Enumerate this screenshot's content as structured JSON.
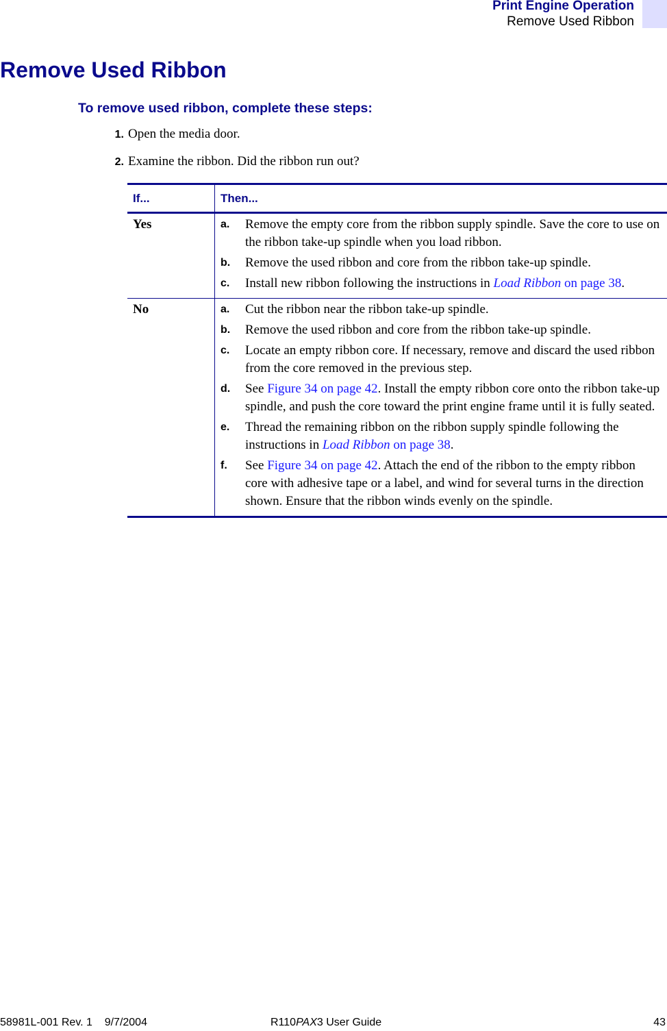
{
  "header": {
    "section": "Print Engine Operation",
    "topic": "Remove Used Ribbon"
  },
  "title": "Remove Used Ribbon",
  "procedure_heading": "To remove used ribbon, complete these steps:",
  "steps": [
    {
      "num": "1.",
      "text": "Open the media door."
    },
    {
      "num": "2.",
      "text": "Examine the ribbon. Did the ribbon run out?"
    }
  ],
  "table": {
    "headers": [
      "If...",
      "Then..."
    ],
    "rows": [
      {
        "condition": "Yes",
        "actions": [
          {
            "letter": "a.",
            "text": "Remove the empty core from the ribbon supply spindle. Save the core to use on the ribbon take-up spindle when you load ribbon."
          },
          {
            "letter": "b.",
            "text": "Remove the used ribbon and core from the ribbon take-up spindle."
          },
          {
            "letter": "c.",
            "pre": "Install new ribbon following the instructions in ",
            "link_italic": "Load Ribbon",
            "link_plain": " on page 38",
            "post": "."
          }
        ]
      },
      {
        "condition": "No",
        "actions": [
          {
            "letter": "a.",
            "text": "Cut the ribbon near the ribbon take-up spindle."
          },
          {
            "letter": "b.",
            "text": "Remove the used ribbon and core from the ribbon take-up spindle."
          },
          {
            "letter": "c.",
            "text": "Locate an empty ribbon core. If necessary, remove and discard the used ribbon from the core removed in the previous step."
          },
          {
            "letter": "d.",
            "pre": "See ",
            "link": "Figure 34 on page 42",
            "post": ". Install the empty ribbon core onto the ribbon take-up spindle, and push the core toward the print engine frame until it is fully seated."
          },
          {
            "letter": "e.",
            "pre": "Thread the remaining ribbon on the ribbon supply spindle following the instructions in ",
            "link_italic": "Load Ribbon",
            "link_plain": " on page 38",
            "post": "."
          },
          {
            "letter": "f.",
            "pre": "See ",
            "link": "Figure 34 on page 42",
            "post": ". Attach the end of the ribbon to the empty ribbon core with adhesive tape or a label, and wind for several turns in the direction shown. Ensure that the ribbon winds evenly on the spindle."
          }
        ]
      }
    ]
  },
  "footer": {
    "doc_number": "58981L-001 Rev. 1    9/7/2004",
    "guide_prefix": "R110",
    "guide_italic": "PAX",
    "guide_suffix": "3 User Guide",
    "page_number": "43"
  },
  "colors": {
    "heading": "#0a0a8c",
    "link": "#1a1aff",
    "tab": "#dedeff"
  }
}
